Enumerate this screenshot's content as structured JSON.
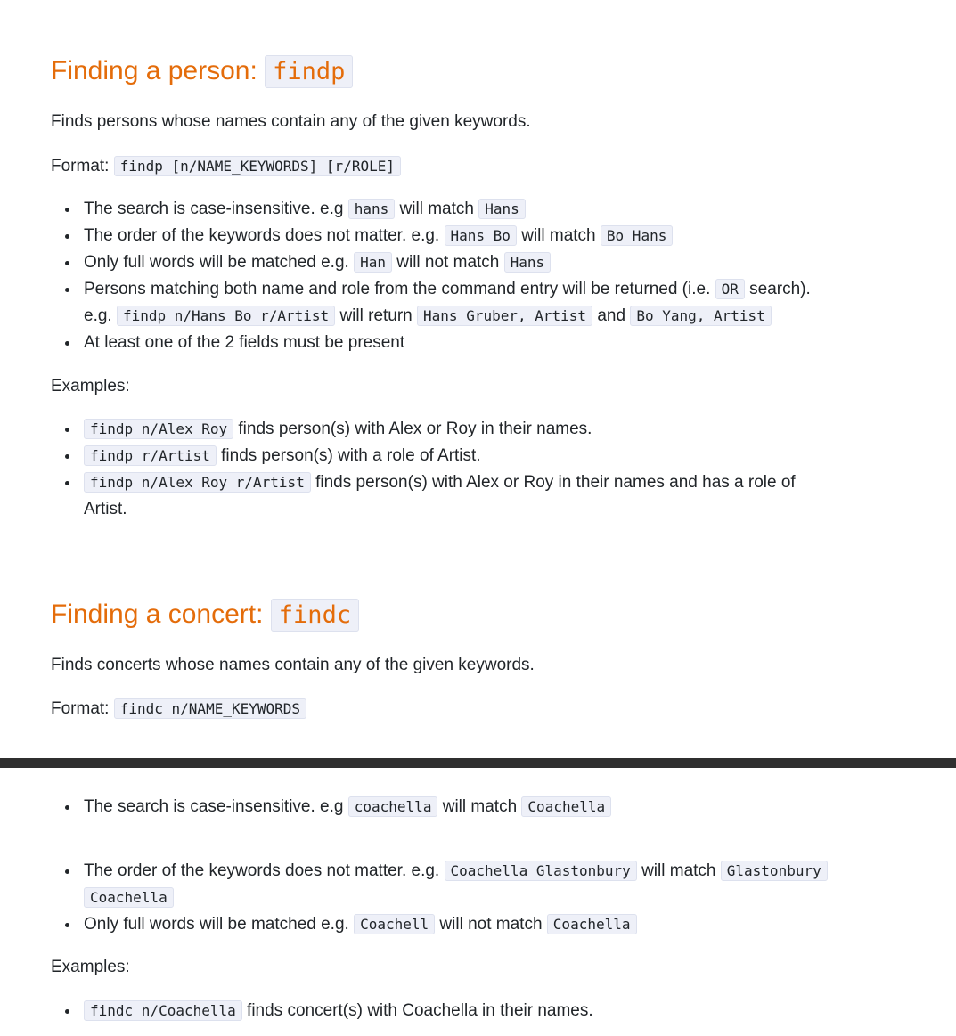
{
  "find_person": {
    "heading_text": "Finding a person: ",
    "heading_code": "findp",
    "description": "Finds persons whose names contain any of the given keywords.",
    "format_label": "Format: ",
    "format_code": "findp [n/NAME_KEYWORDS] [r/ROLE]",
    "rules": {
      "r1": {
        "t1": "The search is case-insensitive. e.g ",
        "c1": "hans",
        "t2": " will match ",
        "c2": "Hans"
      },
      "r2": {
        "t1": "The order of the keywords does not matter. e.g. ",
        "c1": "Hans Bo",
        "t2": " will match ",
        "c2": "Bo Hans"
      },
      "r3": {
        "t1": "Only full words will be matched e.g. ",
        "c1": "Han",
        "t2": " will not match ",
        "c2": "Hans"
      },
      "r4": {
        "t1": "Persons matching both name and role from the command entry will be returned (i.e. ",
        "c1": "OR",
        "t2": " search).",
        "t3": "e.g. ",
        "c2": "findp n/Hans Bo r/Artist",
        "t4": " will return ",
        "c3": "Hans Gruber, Artist",
        "t5": " and ",
        "c4": "Bo Yang, Artist"
      },
      "r5": {
        "t1": "At least one of the 2 fields must be present"
      }
    },
    "examples_label": "Examples:",
    "examples": {
      "e1": {
        "code": "findp n/Alex Roy",
        "text": " finds person(s) with Alex or Roy in their names."
      },
      "e2": {
        "code": "findp r/Artist",
        "text": " finds person(s) with a role of Artist."
      },
      "e3": {
        "code": "findp n/Alex Roy r/Artist",
        "text": " finds person(s) with Alex or Roy in their names and has a role of",
        "text2": "Artist."
      }
    }
  },
  "find_concert": {
    "heading_text": "Finding a concert: ",
    "heading_code": "findc",
    "description": "Finds concerts whose names contain any of the given keywords.",
    "format_label": "Format: ",
    "format_code": "findc n/NAME_KEYWORDS",
    "rules": {
      "r1": {
        "t1": "The search is case-insensitive. e.g ",
        "c1": "coachella",
        "t2": " will match ",
        "c2": "Coachella"
      },
      "r2": {
        "t1": "The order of the keywords does not matter. e.g. ",
        "c1": "Coachella Glastonbury",
        "t2": " will match ",
        "c2a": "Glastonbury",
        "c2b": "Coachella"
      },
      "r3": {
        "t1": "Only full words will be matched e.g. ",
        "c1": "Coachell",
        "t2": " will not match ",
        "c2": "Coachella"
      }
    },
    "examples_label": "Examples:",
    "examples": {
      "e1": {
        "code": "findc n/Coachella",
        "text": " finds concert(s) with Coachella in their names."
      }
    }
  }
}
